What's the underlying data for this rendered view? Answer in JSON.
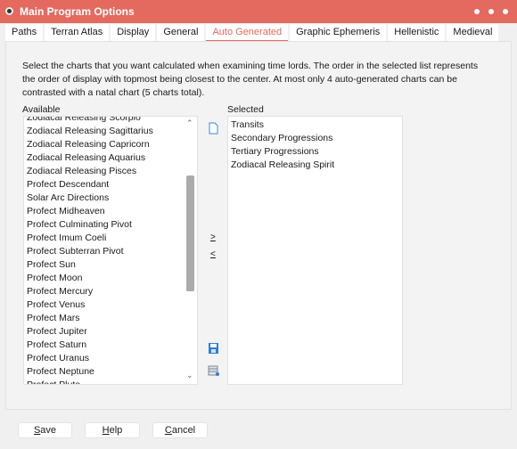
{
  "window": {
    "title": "Main Program Options"
  },
  "tabs": [
    {
      "label": "Paths"
    },
    {
      "label": "Terran Atlas"
    },
    {
      "label": "Display"
    },
    {
      "label": "General"
    },
    {
      "label": "Auto Generated",
      "active": true
    },
    {
      "label": "Graphic Ephemeris"
    },
    {
      "label": "Hellenistic"
    },
    {
      "label": "Medieval"
    }
  ],
  "description": "Select the charts that you want calculated when examining time lords.  The order in the selected list represents the order of display with topmost being closest to the center.  At most only 4 auto-generated charts can be contrasted with a natal chart (5 charts total).",
  "available": {
    "label": "Available",
    "items": [
      "Zodiacal Releasing Scorpio",
      "Zodiacal Releasing Sagittarius",
      "Zodiacal Releasing Capricorn",
      "Zodiacal Releasing Aquarius",
      "Zodiacal Releasing Pisces",
      "Profect Descendant",
      "Solar Arc Directions",
      "Profect Midheaven",
      "Profect Culminating Pivot",
      "Profect Imum Coeli",
      "Profect Subterran Pivot",
      "Profect Sun",
      "Profect Moon",
      "Profect Mercury",
      "Profect Venus",
      "Profect Mars",
      "Profect Jupiter",
      "Profect Saturn",
      "Profect Uranus",
      "Profect Neptune",
      "Profect Pluto"
    ]
  },
  "selected": {
    "label": "Selected",
    "items": [
      "Transits",
      "Secondary Progressions",
      "Tertiary Progressions",
      "Zodiacal Releasing Spirit"
    ]
  },
  "controls": {
    "add": ">",
    "remove": "<"
  },
  "buttons": {
    "save": "Save",
    "help": "Help",
    "cancel": "Cancel"
  },
  "colors": {
    "accent": "#e4695f"
  }
}
